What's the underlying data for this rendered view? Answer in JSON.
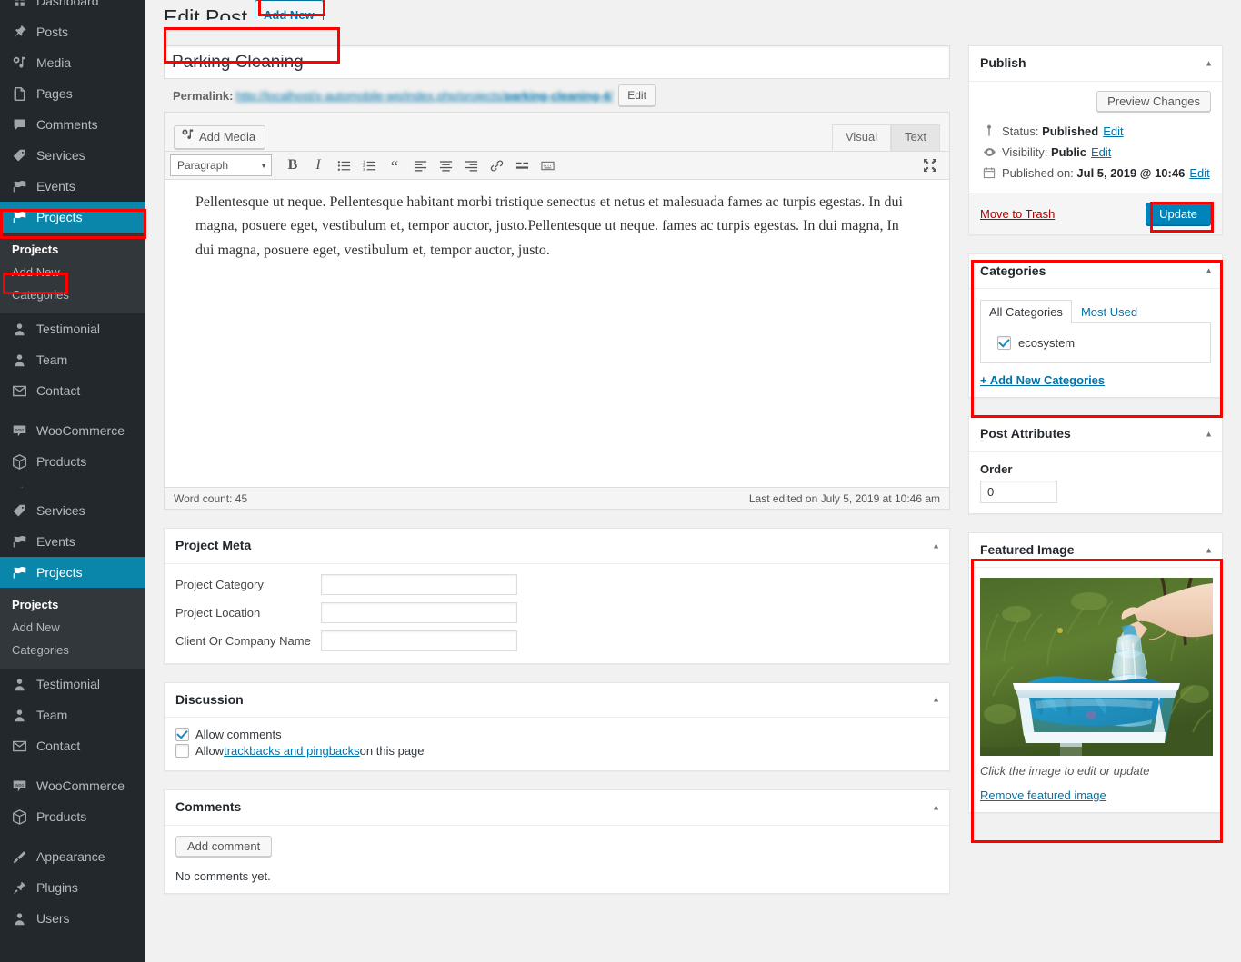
{
  "sidebar": {
    "items": [
      {
        "label": "Dashboard",
        "icon": "dashboard-icon"
      },
      {
        "label": "Posts",
        "icon": "pin-icon"
      },
      {
        "label": "Media",
        "icon": "media-icon"
      },
      {
        "label": "Pages",
        "icon": "pages-icon"
      },
      {
        "label": "Comments",
        "icon": "comment-icon"
      },
      {
        "label": "Services",
        "icon": "tag-icon"
      },
      {
        "label": "Events",
        "icon": "flag-icon"
      },
      {
        "label": "Projects",
        "icon": "flag-icon"
      }
    ],
    "submenu": {
      "title": "Projects",
      "items": [
        "Add New",
        "Categories"
      ]
    },
    "items2": [
      {
        "label": "Testimonial",
        "icon": "user-icon"
      },
      {
        "label": "Team",
        "icon": "user-icon"
      },
      {
        "label": "Contact",
        "icon": "email-icon"
      },
      {
        "label": "WooCommerce",
        "icon": "woo-icon"
      },
      {
        "label": "Products",
        "icon": "products-icon"
      }
    ],
    "items3": [
      {
        "label": "Services",
        "icon": "tag-icon"
      },
      {
        "label": "Events",
        "icon": "flag-icon"
      },
      {
        "label": "Projects",
        "icon": "flag-icon"
      }
    ],
    "items4": [
      {
        "label": "Testimonial",
        "icon": "user-icon"
      },
      {
        "label": "Team",
        "icon": "user-icon"
      },
      {
        "label": "Contact",
        "icon": "email-icon"
      },
      {
        "label": "WooCommerce",
        "icon": "woo-icon"
      },
      {
        "label": "Products",
        "icon": "products-icon"
      }
    ],
    "items5": [
      {
        "label": "Appearance",
        "icon": "brush-icon"
      },
      {
        "label": "Plugins",
        "icon": "plugin-icon"
      },
      {
        "label": "Users",
        "icon": "user-icon"
      }
    ]
  },
  "header": {
    "title": "Edit Post",
    "add_new": "Add New"
  },
  "post": {
    "title": "Parking Cleaning",
    "permalink_label": "Permalink:",
    "permalink_base": "http://localhost/x-automobile-wp/index.php/projects/",
    "permalink_slug": "parking-cleaning-4",
    "permalink_suffix": "/",
    "edit_slug_button": "Edit"
  },
  "editor": {
    "add_media": "Add Media",
    "tab_visual": "Visual",
    "tab_text": "Text",
    "format_select": "Paragraph",
    "toolbar_buttons": [
      "bold",
      "italic",
      "bulleted-list",
      "numbered-list",
      "blockquote",
      "align-left",
      "align-center",
      "align-right",
      "insert-link",
      "insert-read-more",
      "toolbar-toggle"
    ],
    "fullscreen": "distraction-free-icon",
    "content": "Pellentesque ut neque. Pellentesque habitant morbi tristique senectus et netus et malesuada fames ac turpis egestas. In dui magna, posuere eget, vestibulum et, tempor auctor, justo.Pellentesque ut neque. fames ac turpis egestas. In dui magna, In dui magna, posuere eget, vestibulum et, tempor auctor, justo.",
    "word_count": "Word count: 45",
    "last_edited": "Last edited on July 5, 2019 at 10:46 am"
  },
  "project_meta": {
    "title": "Project Meta",
    "rows": [
      {
        "label": "Project Category",
        "value": ""
      },
      {
        "label": "Project Location",
        "value": ""
      },
      {
        "label": "Client Or Company Name",
        "value": ""
      }
    ]
  },
  "discussion": {
    "title": "Discussion",
    "allow_comments": "Allow comments",
    "allow_comments_checked": true,
    "trackbacks_prefix": "Allow ",
    "trackbacks_link": "trackbacks and pingbacks",
    "trackbacks_suffix": " on this page",
    "trackbacks_checked": false
  },
  "comments": {
    "title": "Comments",
    "add_comment": "Add comment",
    "empty": "No comments yet."
  },
  "publish": {
    "title": "Publish",
    "preview": "Preview Changes",
    "status_label": "Status:",
    "status_value": "Published",
    "status_edit": "Edit",
    "visibility_label": "Visibility:",
    "visibility_value": "Public",
    "visibility_edit": "Edit",
    "published_label": "Published on:",
    "published_value": "Jul 5, 2019 @ 10:46",
    "published_edit": "Edit",
    "trash": "Move to Trash",
    "update": "Update"
  },
  "categories": {
    "title": "Categories",
    "tab_all": "All Categories",
    "tab_most_used": "Most Used",
    "items": [
      {
        "label": "ecosystem",
        "checked": true
      }
    ],
    "add_new": "+ Add New Categories"
  },
  "post_attributes": {
    "title": "Post Attributes",
    "order_label": "Order",
    "order_value": "0"
  },
  "featured_image": {
    "title": "Featured Image",
    "hint": "Click the image to edit or update",
    "remove": "Remove featured image",
    "alt": "hand placing plastic bottle into blue recycling bin on grass"
  },
  "colors": {
    "sidebar_bg": "#23282d",
    "submenu_bg": "#32373c",
    "accent": "#0a86ab",
    "primary_button": "#0085ba",
    "link": "#0073aa",
    "annotation": "#ff0000",
    "trash_link": "#a00"
  }
}
